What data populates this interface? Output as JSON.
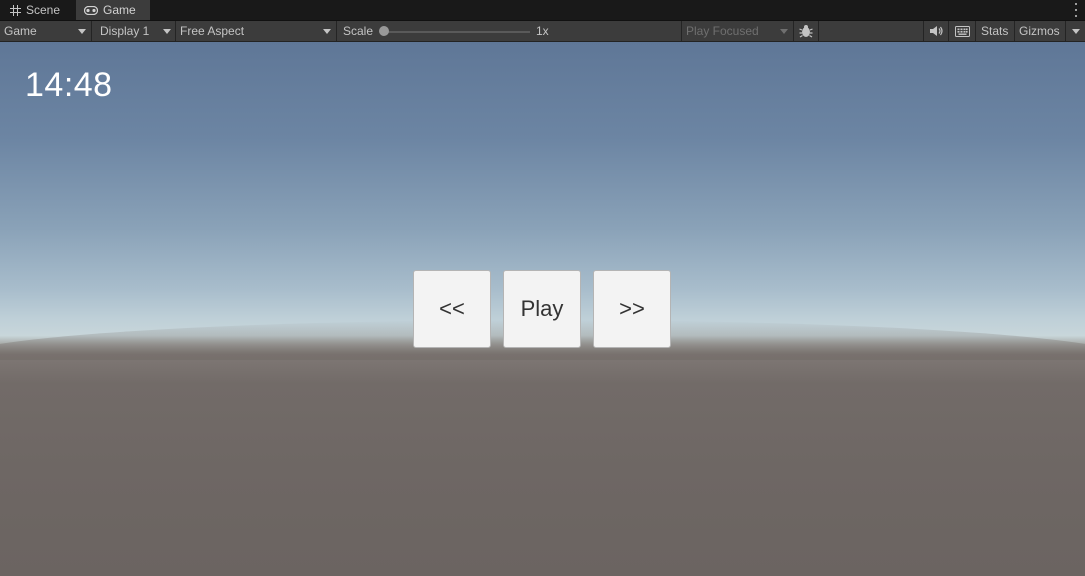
{
  "tabs": [
    {
      "label": "Scene",
      "icon": "grid-icon",
      "active": false
    },
    {
      "label": "Game",
      "icon": "gamepad-icon",
      "active": true
    }
  ],
  "toolbar": {
    "view_mode": "Game",
    "display": "Display 1",
    "aspect": "Free Aspect",
    "scale_label": "Scale",
    "scale_value": "1x",
    "play_mode": "Play Focused",
    "stats_label": "Stats",
    "gizmos_label": "Gizmos"
  },
  "game": {
    "time": "14:48",
    "buttons": {
      "prev": "<<",
      "play": "Play",
      "next": ">>"
    }
  },
  "colors": {
    "toolbar_bg": "#3c3c3c",
    "tabbar_bg": "#191919",
    "sky_top": "#5f7797",
    "ground": "#6e6764",
    "button_bg": "#f3f3f3"
  }
}
